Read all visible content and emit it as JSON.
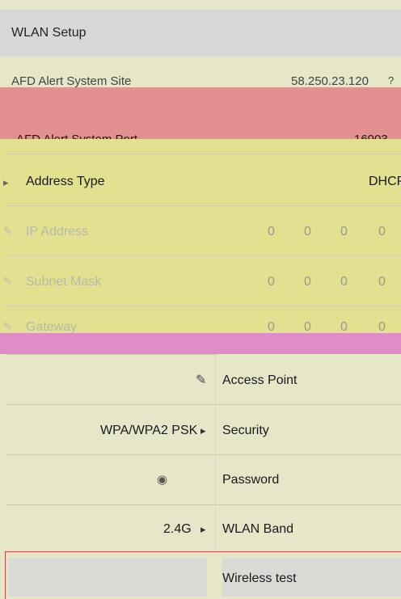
{
  "header": {
    "title": "WLAN Setup"
  },
  "rows": {
    "afd_site": {
      "label": "AFD Alert System Site",
      "value": "58.250.23.120",
      "suffix": "?"
    },
    "afd_port": {
      "label": "AFD Alert System Port",
      "value": "16903"
    },
    "address_type": {
      "label": "Address Type",
      "value": "DHCP"
    },
    "ip_address": {
      "label": "IP Address",
      "octets": [
        "0",
        "0",
        "0",
        "0"
      ]
    },
    "subnet_mask": {
      "label": "Subnet Mask",
      "octets": [
        "0",
        "0",
        "0",
        "0"
      ]
    },
    "gateway": {
      "label": "Gateway",
      "octets": [
        "0",
        "0",
        "0",
        "0"
      ]
    }
  },
  "wlan": {
    "access_point": {
      "label": "Access Point"
    },
    "security": {
      "label": "Security",
      "value": "WPA/WPA2 PSK"
    },
    "password": {
      "label": "Password"
    },
    "wlan_band": {
      "label": "WLAN Band",
      "value": "2.4G"
    },
    "wireless_test": {
      "label": "Wireless test"
    }
  },
  "colors": {
    "red_band": "#e29090",
    "yellow_band": "#e3e08f",
    "pink_band": "#e08cc8",
    "bg": "#e6e6c9"
  }
}
